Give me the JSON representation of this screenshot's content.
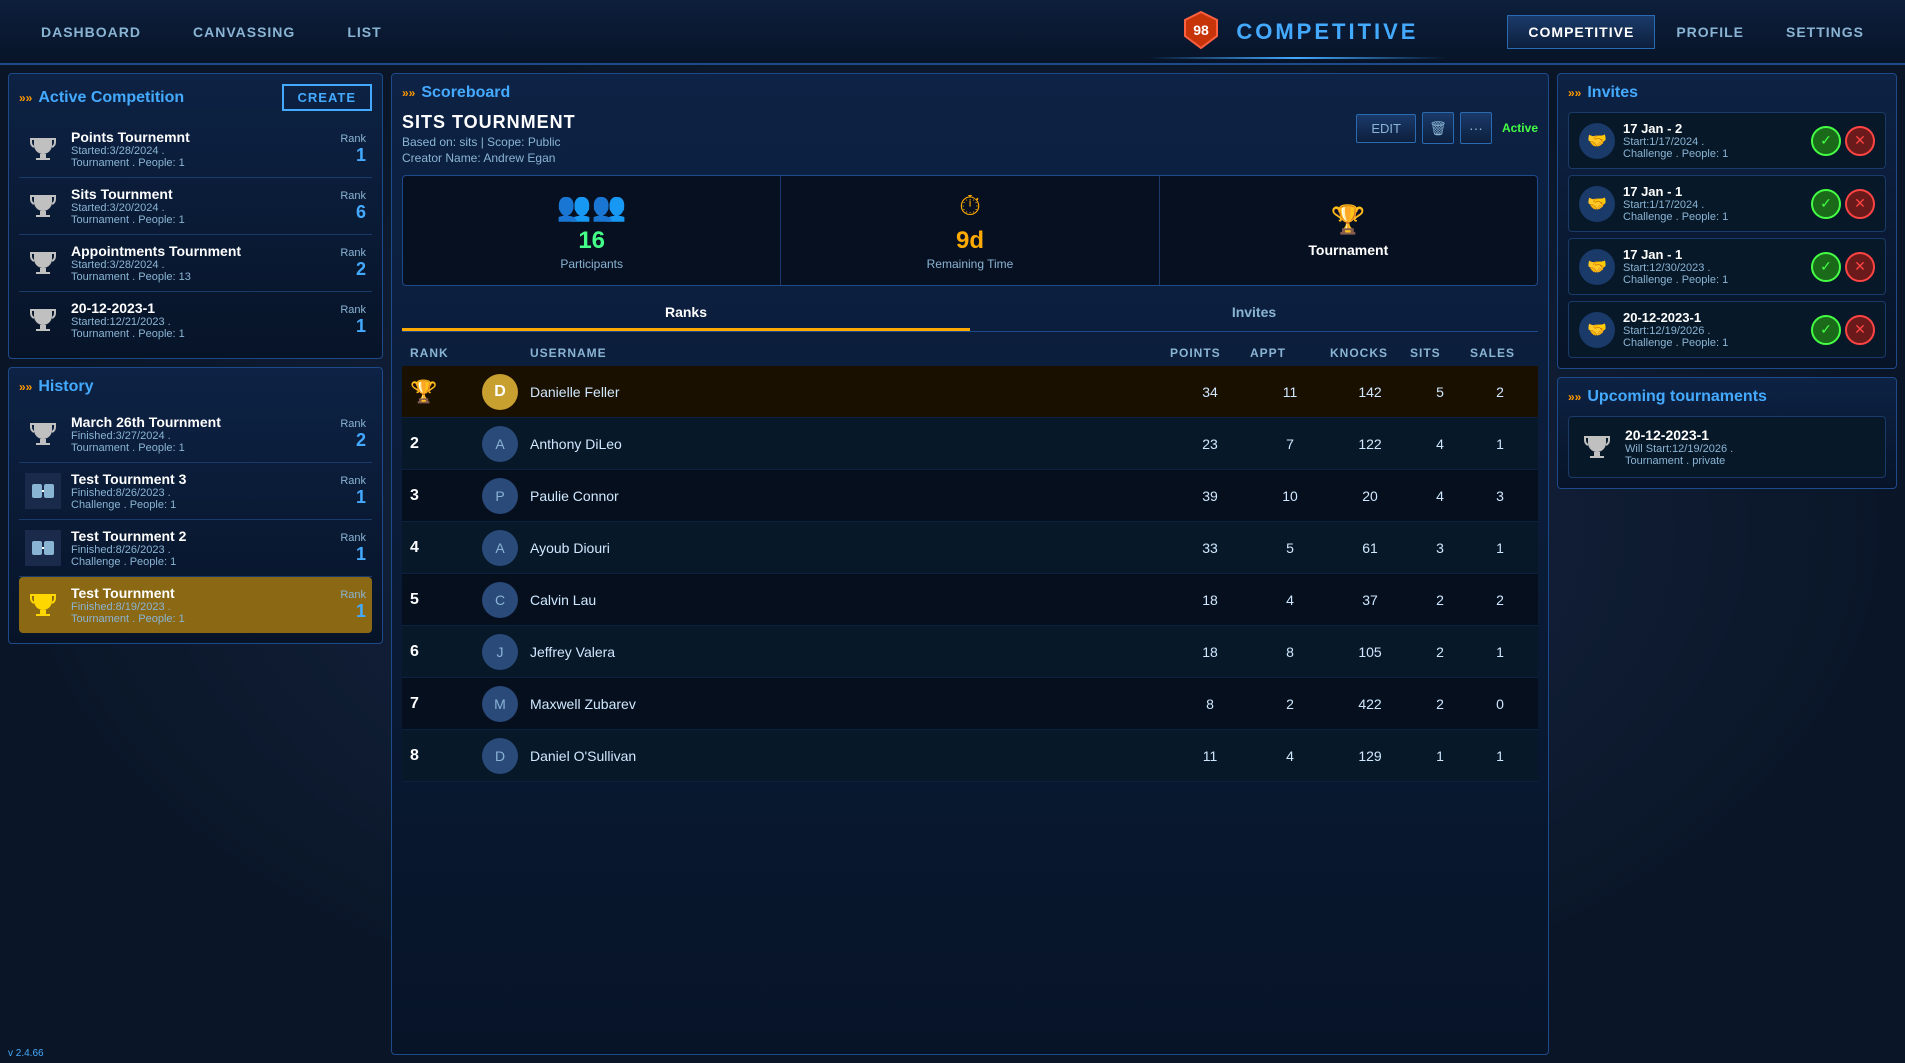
{
  "nav": {
    "badge": "98",
    "center_title": "COMPETITIVE",
    "items": [
      {
        "label": "DASHBOARD",
        "active": false
      },
      {
        "label": "CANVASSING",
        "active": false
      },
      {
        "label": "LIST",
        "active": false
      }
    ],
    "right_items": [
      {
        "label": "COMPETITIVE",
        "active": true
      },
      {
        "label": "PROFILE",
        "active": false
      },
      {
        "label": "SETTINGS",
        "active": false
      }
    ]
  },
  "left": {
    "active_competition": {
      "title": "Active Competition",
      "create_btn": "CREATE",
      "items": [
        {
          "name": "Points Tournemnt",
          "detail1": "Started:3/28/2024 .",
          "detail2": "Tournament . People: 1",
          "rank": "1",
          "type": "tournament"
        },
        {
          "name": "Sits Tournment",
          "detail1": "Started:3/20/2024 .",
          "detail2": "Tournament . People: 1",
          "rank": "6",
          "type": "tournament"
        },
        {
          "name": "Appointments Tournment",
          "detail1": "Started:3/28/2024 .",
          "detail2": "Tournament . People: 13",
          "rank": "2",
          "type": "tournament"
        },
        {
          "name": "20-12-2023-1",
          "detail1": "Started:12/21/2023 .",
          "detail2": "Tournament . People: 1",
          "rank": "1",
          "type": "tournament"
        }
      ]
    },
    "history": {
      "title": "History",
      "items": [
        {
          "name": "March 26th Tournment",
          "detail1": "Finished:3/27/2024 .",
          "detail2": "Tournament . People: 1",
          "rank": "2",
          "type": "tournament",
          "highlighted": false
        },
        {
          "name": "Test Tournment 3",
          "detail1": "Finished:8/26/2023 .",
          "detail2": "Challenge . People: 1",
          "rank": "1",
          "type": "challenge",
          "highlighted": false
        },
        {
          "name": "Test Tournment 2",
          "detail1": "Finished:8/26/2023 .",
          "detail2": "Challenge . People: 1",
          "rank": "1",
          "type": "challenge",
          "highlighted": false
        },
        {
          "name": "Test Tournment",
          "detail1": "Finished:8/19/2023 .",
          "detail2": "Tournament . People: 1",
          "rank": "1",
          "type": "tournament",
          "highlighted": true
        }
      ]
    }
  },
  "center": {
    "scoreboard": {
      "title": "Scoreboard",
      "tournament_name": "SITS TOURNMENT",
      "based_on": "Based on: sits | Scope: Public",
      "creator": "Creator Name: Andrew Egan",
      "status": "Active",
      "edit_btn": "EDIT",
      "stats": {
        "participants": {
          "value": "16",
          "label": "Participants"
        },
        "remaining": {
          "value": "9d",
          "label": "Remaining Time"
        },
        "type": {
          "label": "Tournament"
        }
      },
      "tabs": [
        {
          "label": "Ranks",
          "active": true
        },
        {
          "label": "Invites",
          "active": false
        }
      ],
      "table": {
        "headers": [
          "RANK",
          "",
          "USERNAME",
          "POINTS",
          "APPT",
          "KNOCKS",
          "SITS",
          "SALES"
        ],
        "rows": [
          {
            "rank": "1",
            "username": "Danielle Feller",
            "points": "34",
            "appt": "11",
            "knocks": "142",
            "sits": "5",
            "sales": "2",
            "gold": true
          },
          {
            "rank": "2",
            "username": "Anthony DiLeo",
            "points": "23",
            "appt": "7",
            "knocks": "122",
            "sits": "4",
            "sales": "1",
            "gold": false
          },
          {
            "rank": "3",
            "username": "Paulie Connor",
            "points": "39",
            "appt": "10",
            "knocks": "20",
            "sits": "4",
            "sales": "3",
            "gold": false
          },
          {
            "rank": "4",
            "username": "Ayoub Diouri",
            "points": "33",
            "appt": "5",
            "knocks": "61",
            "sits": "3",
            "sales": "1",
            "gold": false
          },
          {
            "rank": "5",
            "username": "Calvin Lau",
            "points": "18",
            "appt": "4",
            "knocks": "37",
            "sits": "2",
            "sales": "2",
            "gold": false
          },
          {
            "rank": "6",
            "username": "Jeffrey Valera",
            "points": "18",
            "appt": "8",
            "knocks": "105",
            "sits": "2",
            "sales": "1",
            "gold": false
          },
          {
            "rank": "7",
            "username": "Maxwell Zubarev",
            "points": "8",
            "appt": "2",
            "knocks": "422",
            "sits": "2",
            "sales": "0",
            "gold": false
          },
          {
            "rank": "8",
            "username": "Daniel O'Sullivan",
            "points": "11",
            "appt": "4",
            "knocks": "129",
            "sits": "1",
            "sales": "1",
            "gold": false
          }
        ]
      }
    }
  },
  "right": {
    "invites": {
      "title": "Invites",
      "items": [
        {
          "name": "17 Jan - 2",
          "detail1": "Start:1/17/2024 .",
          "detail2": "Challenge . People: 1"
        },
        {
          "name": "17 Jan - 1",
          "detail1": "Start:1/17/2024 .",
          "detail2": "Challenge . People: 1"
        },
        {
          "name": "17 Jan - 1",
          "detail1": "Start:12/30/2023 .",
          "detail2": "Challenge . People: 1"
        },
        {
          "name": "20-12-2023-1",
          "detail1": "Start:12/19/2026 .",
          "detail2": "Challenge . People: 1"
        }
      ]
    },
    "upcoming": {
      "title": "Upcoming tournaments",
      "items": [
        {
          "name": "20-12-2023-1",
          "detail1": "Will Start:12/19/2026 .",
          "detail2": "Tournament . private"
        }
      ]
    }
  },
  "version": "v 2.4.66"
}
